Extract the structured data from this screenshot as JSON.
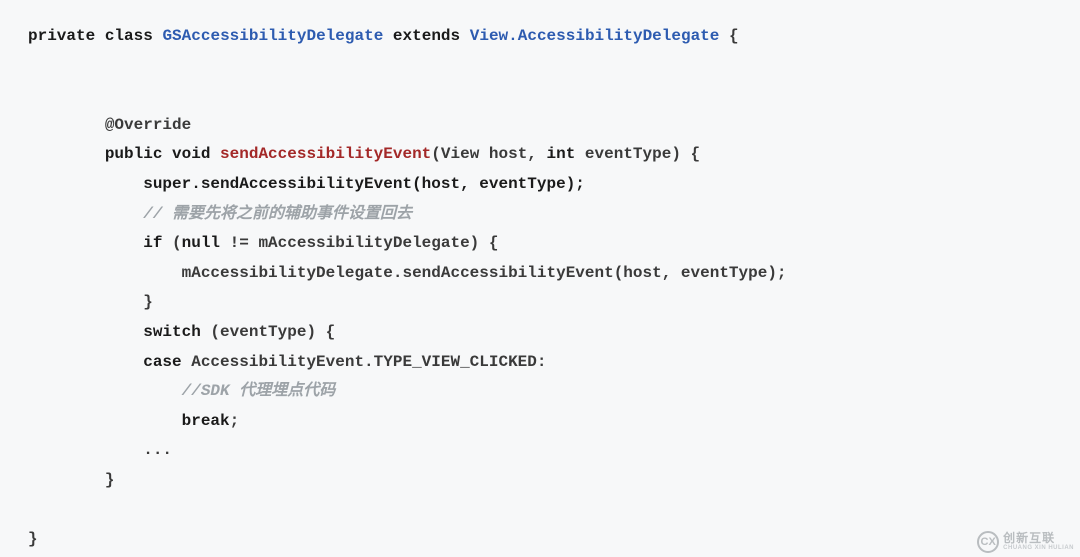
{
  "code": {
    "l1": {
      "kw_private": "private",
      "kw_class": "class",
      "class_name": "GSAccessibilityDelegate",
      "kw_extends": "extends",
      "super_name": "View.AccessibilityDelegate",
      "open": " {"
    },
    "l2": "",
    "l3": "",
    "l4": {
      "annotation": "@Override"
    },
    "l5": {
      "kw_public": "public",
      "kw_void": "void",
      "method": "sendAccessibilityEvent",
      "params_open": "(View host, ",
      "kw_int": "int",
      "params_close": " eventType) {"
    },
    "l6": "super.sendAccessibilityEvent(host, eventType);",
    "l7": "// 需要先将之前的辅助事件设置回去",
    "l8a": "if",
    "l8b": " (",
    "l8c": "null",
    "l8d": " != mAccessibilityDelegate) {",
    "l9": "mAccessibilityDelegate.sendAccessibilityEvent(host, eventType);",
    "l10": "}",
    "l11a": "switch",
    "l11b": " (eventType) {",
    "l12a": "case",
    "l12b": " AccessibilityEvent.TYPE_VIEW_CLICKED:",
    "l13": "//SDK 代理埋点代码",
    "l14": "break",
    "l14b": ";",
    "l15": "...",
    "l16": "}",
    "l17": "",
    "l18": "}"
  },
  "watermark": {
    "logo": "CX",
    "text": "创新互联",
    "sub": "CHUANG XIN HULIAN"
  }
}
